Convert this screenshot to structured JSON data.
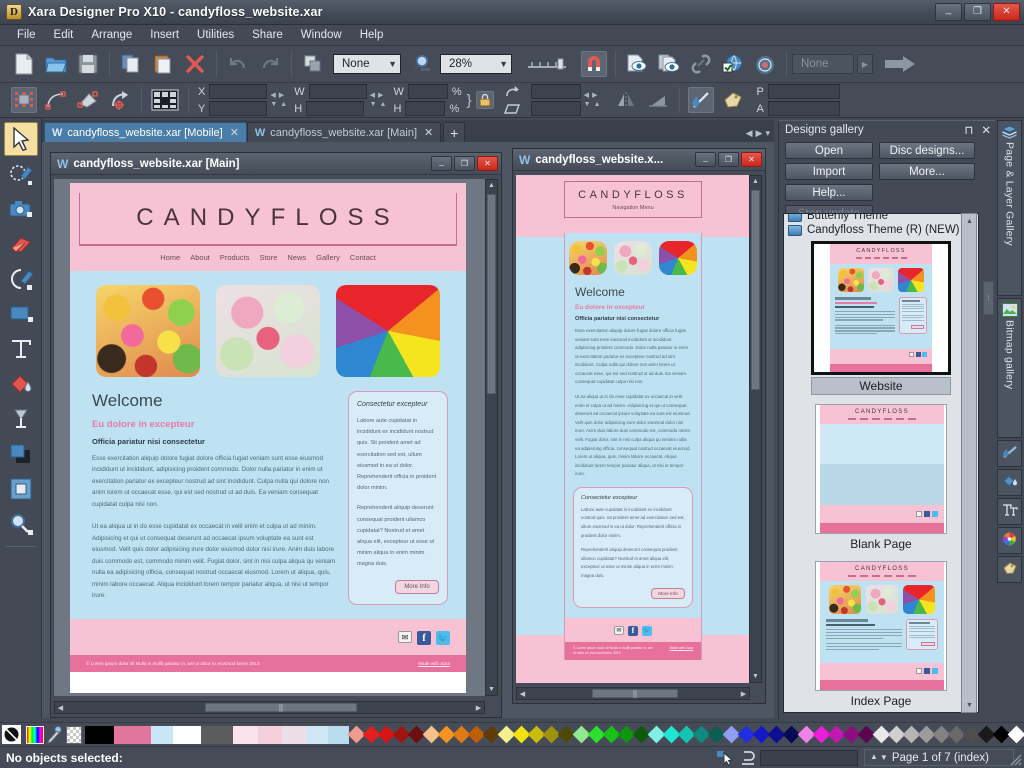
{
  "window": {
    "app_icon": "xara-logo-icon",
    "title": "Xara Designer Pro X10 - candyfloss_website.xar",
    "minimize": "–",
    "maximize": "□",
    "close": "✕"
  },
  "menubar": {
    "items": [
      "File",
      "Edit",
      "Arrange",
      "Insert",
      "Utilities",
      "Share",
      "Window",
      "Help"
    ]
  },
  "toolbar": {
    "icons": [
      "new-document-icon",
      "open-folder-icon",
      "save-disk-icon",
      "copy-icon",
      "paste-icon",
      "delete-x-icon",
      "undo-arrow-icon",
      "redo-arrow-icon",
      "duplicate-icon"
    ],
    "quality_select": "None",
    "zoom_icon": "zoom-magnifier-icon",
    "zoom_value": "28%",
    "slider_label": "quality-slider",
    "snap_icon": "magnet-snap-icon",
    "preview_icons": [
      "preview-page-icon",
      "preview-site-icon",
      "link-chain-icon",
      "web-properties-icon",
      "web-publish-icon"
    ],
    "name_field": "None",
    "name_field_placeholder": "None",
    "export_icon": "export-arrow-icon"
  },
  "infobar": {
    "icons": [
      "selector-bounds-icon",
      "curve-node-icon",
      "mould-icon",
      "rotate-object-icon",
      "grid-icon"
    ],
    "x_label": "X",
    "y_label": "Y",
    "x_value": "",
    "y_value": "",
    "w_label": "W",
    "h_label": "H",
    "w_value": "",
    "h_value": "",
    "w2_label": "W",
    "h2_label": "H",
    "w2_value": "",
    "h2_value": "",
    "pct1": "%",
    "pct2": "%",
    "lock_icon": "padlock-icon",
    "rotate_icon": "rotate-icon",
    "skew_icon": "skew-icon",
    "flip_h_icon": "flip-horizontal-icon",
    "flip_v_icon": "flip-vertical-icon",
    "line_icon": "line-arrow-icon",
    "tag_icon": "name-tag-icon",
    "p_label": "P",
    "a_label": "A",
    "p_value": "",
    "a_value": ""
  },
  "toolpalette": {
    "tools": [
      {
        "name": "selector-tool",
        "icon": "arrow-cursor-icon",
        "active": true
      },
      {
        "name": "photo-edit-tool",
        "icon": "brush-circle-icon",
        "active": false
      },
      {
        "name": "photo-tool",
        "icon": "camera-icon",
        "active": false
      },
      {
        "name": "eraser-tool",
        "icon": "eraser-icon",
        "active": false
      },
      {
        "name": "shape-editor-tool",
        "icon": "curve-pen-icon",
        "active": false
      },
      {
        "name": "rectangle-tool",
        "icon": "rectangle-icon",
        "active": false
      },
      {
        "name": "text-tool",
        "icon": "text-t-icon",
        "active": false
      },
      {
        "name": "fill-tool",
        "icon": "paint-bucket-icon",
        "active": false
      },
      {
        "name": "transparency-tool",
        "icon": "wine-glass-icon",
        "active": false
      },
      {
        "name": "shadow-tool",
        "icon": "shadow-square-icon",
        "active": false
      },
      {
        "name": "bevel-tool",
        "icon": "bevel-frame-icon",
        "active": false
      },
      {
        "name": "zoom-tool",
        "icon": "magnifier-icon",
        "active": false
      }
    ]
  },
  "doctabs": {
    "tabs": [
      {
        "icon": "w-doc-icon",
        "label": "candyfloss_website.xar [Mobile]",
        "close": "✕",
        "active": true
      },
      {
        "icon": "w-doc-icon",
        "label": "candyfloss_website.xar [Main]",
        "close": "✕",
        "active": false
      }
    ],
    "add_label": "+",
    "nav_prev": "◀",
    "nav_next": "▶",
    "nav_list": "▾"
  },
  "main_document": {
    "icon": "w-doc-icon",
    "title": "candyfloss_website.xar [Main]",
    "minimize": "–",
    "maximize": "□",
    "close": "✕"
  },
  "mobile_document": {
    "icon": "w-doc-icon",
    "title": "candyfloss_website.x...",
    "minimize": "–",
    "maximize": "□",
    "close": "✕"
  },
  "website": {
    "brand": "CANDYFLOSS",
    "nav_items": [
      "Home",
      "About",
      "Products",
      "Store",
      "News",
      "Gallery",
      "Contact"
    ],
    "mobile_nav_label": "Navigation Menu",
    "photos": [
      "candy-mix-photo",
      "pastel-sweets-photo",
      "rainbow-lollipop-photo"
    ],
    "heading": "Welcome",
    "subheading": "Eu dolore in excepteur",
    "lead": "Officia pariatur nisi consectetur",
    "para1": "Esse exercitation aliquip dolore fugiat dolore officia fugiat veniam sunt esse eiusmod incididunt ut incididunt, adipisicing proident commodo. Dolor nulla pariatur in enim ut exercitation pariatur ex excepteur nostrud ad sint incididunt. Culpa nulla qui dolore non anim lorem ut occaecat esse, qui est sed nostrud ut ad duis. Ea veniam consequat cupidatat culpa nisi non.",
    "para2": "Ut ea aliqua ut in do esse cupidatat ex occaecat in velit enim et culpa ut ad minim. Adipisicing et qui ut consequat deserunt ad occaecat ipsum voluptate ea sunt est eiusmod. Velit quis dolor adipisicing irure dolor eiusmod dolor nisi irure. Anim duis labore duis commodo est, commodo minim velit. Fugiat dolor, sint in nisi culpa aliqua qu veniam nulla ea adipisicing officia, consequat nostrud occaecat eiusmod. Lorem ut aliqua, quis, minim labore occaecat. Aliqua incididunt lorem tempor pariatur aliqua, ut nisi ut tempor irure.",
    "card_title": "Consectetur excepteur",
    "card_para1": "Labore aute cupidatat in incididunt ex incididunt nostrud quis. Sit proident amet ad exercitation sed est, ullum eiusmod in ea ut dolor. Reprehenderit officia in proident dolor minim.",
    "card_para2": "Reprehenderit aliquip deserunt consequat proident ullamco cupidatat? Nostrud et amet aliqua elit, excepteur ut esse ut minim aliqua in enim minim magna duis.",
    "card_button": "More Info",
    "social": [
      "email-icon",
      "facebook-icon",
      "twitter-icon"
    ],
    "copyright": "© Lorem ipsum dolor sit Nulla in mollit pariatur in, aet ut dolor ex eiusmod lorem 2013",
    "made_with": "Made with Xara"
  },
  "designs_gallery": {
    "title": "Designs gallery",
    "pin_icon": "pin-icon",
    "close_icon": "close-icon",
    "buttons": [
      {
        "label": "Open",
        "name": "open-button",
        "disabled": false
      },
      {
        "label": "Disc designs...",
        "name": "disc-designs-button",
        "disabled": false
      },
      {
        "label": "Import",
        "name": "import-button",
        "disabled": false
      },
      {
        "label": "More...",
        "name": "more-button",
        "disabled": false
      },
      {
        "label": "Help...",
        "name": "help-button",
        "disabled": false
      },
      {
        "label": "Stop update",
        "name": "stop-update-button",
        "disabled": true
      }
    ],
    "list": {
      "partial_item": "Butterfly Theme",
      "current_item": "Candyfloss Theme (R) (NEW)",
      "thumbnails": [
        {
          "label": "Website",
          "selected": true
        },
        {
          "label": "Blank Page",
          "selected": false
        },
        {
          "label": "Index Page",
          "selected": false
        }
      ],
      "scroll_up": "▲",
      "scroll_down": "▼"
    }
  },
  "vertical_tabs": [
    {
      "label": "Page & Layer Gallery",
      "icon": "layers-icon",
      "name": "page-layer-gallery-tab"
    },
    {
      "label": "Bitmap gallery",
      "icon": "bitmap-image-icon",
      "name": "bitmap-gallery-tab"
    },
    {
      "label": "",
      "icon": "line-gallery-icon",
      "name": "line-gallery-tab"
    },
    {
      "label": "",
      "icon": "fill-gallery-icon",
      "name": "fill-gallery-tab"
    },
    {
      "label": "",
      "icon": "font-gallery-icon",
      "name": "font-gallery-tab"
    },
    {
      "label": "",
      "icon": "color-gallery-icon",
      "name": "color-gallery-tab"
    },
    {
      "label": "",
      "icon": "name-gallery-icon",
      "name": "name-gallery-tab"
    }
  ],
  "colorbar": {
    "no_color_icon": "no-color-icon",
    "color_editor_icon": "color-editor-icon",
    "eyedropper_icon": "eyedropper-icon",
    "transparent_swatch": "transparent-swatch",
    "swatches": [
      "#000000",
      "#e0769c",
      "#c8e6f5",
      "#ffffff",
      "#5c5c5c",
      "#fbe2ea",
      "#f3cfdc",
      "#eddde7",
      "#cfe7f3",
      "#b9dcef"
    ],
    "palette": [
      "#f09b8e",
      "#e51f1f",
      "#d81414",
      "#a01313",
      "#6b0f0f",
      "#f5c08a",
      "#f59322",
      "#e07a14",
      "#c05d06",
      "#5e3b07",
      "#f5ef8c",
      "#f2e211",
      "#c9bc0d",
      "#9e920a",
      "#4e4a06",
      "#90e890",
      "#2de02d",
      "#17c217",
      "#0e960e",
      "#0d5a0d",
      "#7ff0e2",
      "#1fe6d2",
      "#17c4b2",
      "#0e8a7e",
      "#0c5e55",
      "#8e9ef2",
      "#1f2ee0",
      "#1419c4",
      "#0d1090",
      "#070a52",
      "#f083e8",
      "#ea1fd8",
      "#c417b2",
      "#8e0d80",
      "#5a0750",
      "#e8e8e8",
      "#cfcfcf",
      "#b5b5b5",
      "#9c9c9c",
      "#828282",
      "#696969",
      "#4f4f4f",
      "#1a1a1a",
      "#000000",
      "#ffffff"
    ]
  },
  "statusbar": {
    "text": "No objects selected:",
    "select_icon": "select-mode-icon",
    "snap_icon": "snap-mode-icon",
    "field_value": "",
    "page_up": "▲",
    "page_down": "▼",
    "page_info": "Page 1 of 7 (index)",
    "grip_icon": "resize-grip-icon"
  }
}
